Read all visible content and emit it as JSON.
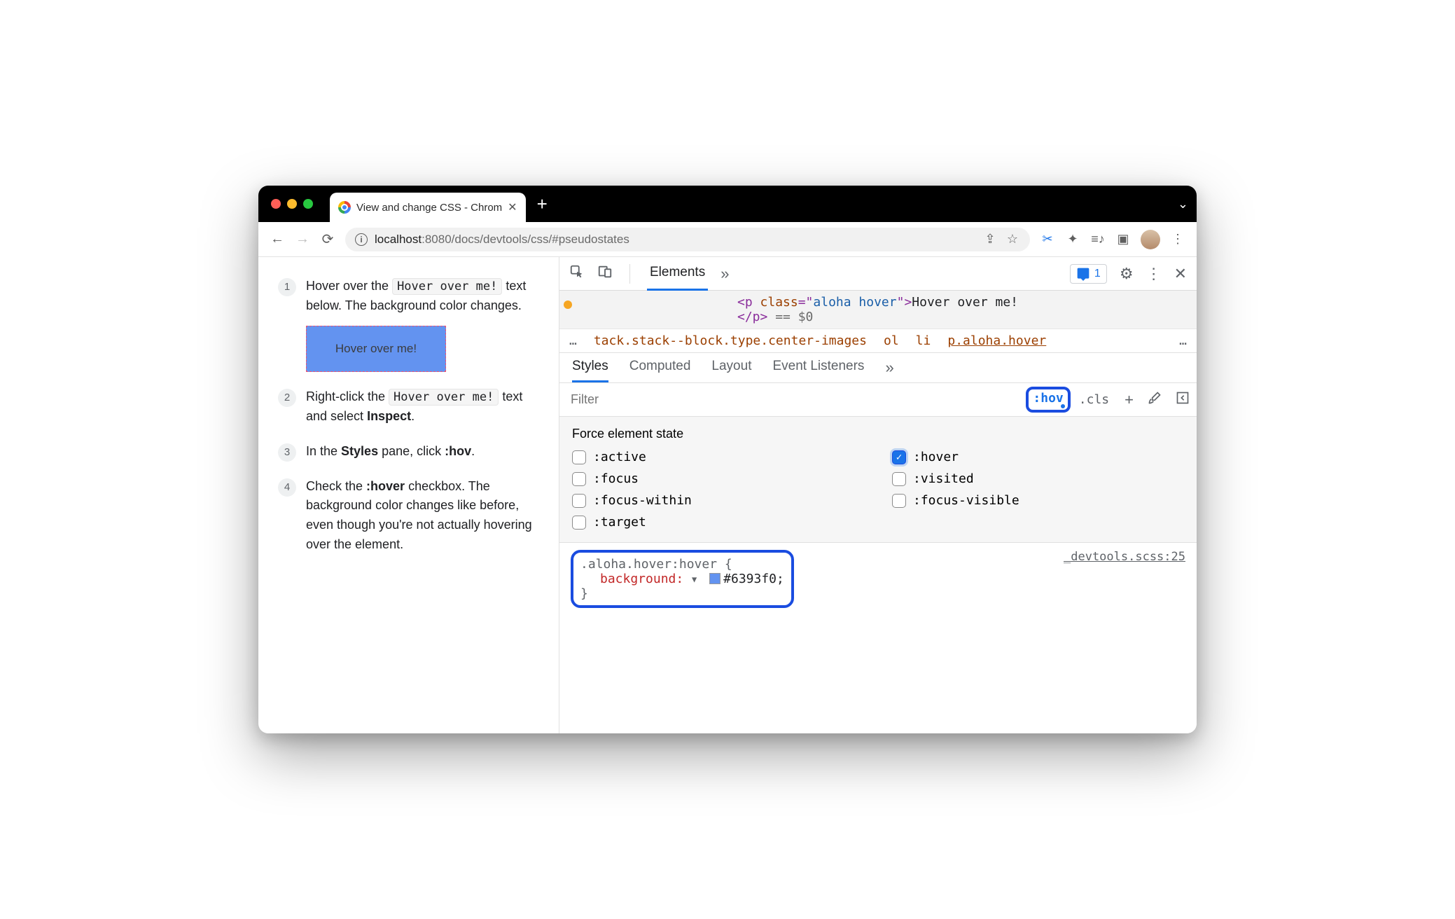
{
  "browser": {
    "tab_title": "View and change CSS - Chrom",
    "url_host": "localhost",
    "url_port": ":8080",
    "url_path": "/docs/devtools/css/#pseudostates"
  },
  "doc": {
    "steps": [
      {
        "n": "1",
        "pre": "Hover over the ",
        "code": "Hover over me!",
        "post": " text below. The background color changes."
      },
      {
        "n": "2",
        "pre": "Right-click the ",
        "code": "Hover over me!",
        "post": " text and select ",
        "bold": "Inspect",
        "tail": "."
      },
      {
        "n": "3",
        "pre": "In the ",
        "bold": "Styles",
        "mid": " pane, click ",
        "bold2": ":hov",
        "tail": "."
      },
      {
        "n": "4",
        "pre": "Check the ",
        "bold": ":hover",
        "post": " checkbox. The background color changes like before, even though you're not actually hovering over the element."
      }
    ],
    "hover_demo": "Hover over me!"
  },
  "devtools": {
    "panel": "Elements",
    "issues_count": "1",
    "html_line1_a": "<p ",
    "html_line1_b": "class",
    "html_line1_c": "=\"",
    "html_line1_d": "aloha hover",
    "html_line1_e": "\">",
    "html_line1_text": "Hover over me!",
    "html_line2": "</p>",
    "html_eqdollar": " == $0",
    "crumbs": {
      "long": "tack.stack--block.type.center-images",
      "ol": "ol",
      "li": "li",
      "sel": "p.aloha.hover"
    },
    "subtabs": [
      "Styles",
      "Computed",
      "Layout",
      "Event Listeners"
    ],
    "filter_placeholder": "Filter",
    "hov_label": ":hov",
    "cls_label": ".cls",
    "force_title": "Force element state",
    "states": [
      {
        "label": ":active",
        "checked": false
      },
      {
        "label": ":hover",
        "checked": true
      },
      {
        "label": ":focus",
        "checked": false
      },
      {
        "label": ":visited",
        "checked": false
      },
      {
        "label": ":focus-within",
        "checked": false
      },
      {
        "label": ":focus-visible",
        "checked": false
      },
      {
        "label": ":target",
        "checked": false
      }
    ],
    "rule_selector": ".aloha.hover:hover {",
    "rule_prop": "background",
    "rule_value": "#6393f0",
    "rule_close": "}",
    "rule_source": "_devtools.scss:25"
  },
  "colors": {
    "accent": "#1a73e8",
    "highlight_box": "#6393f0"
  }
}
